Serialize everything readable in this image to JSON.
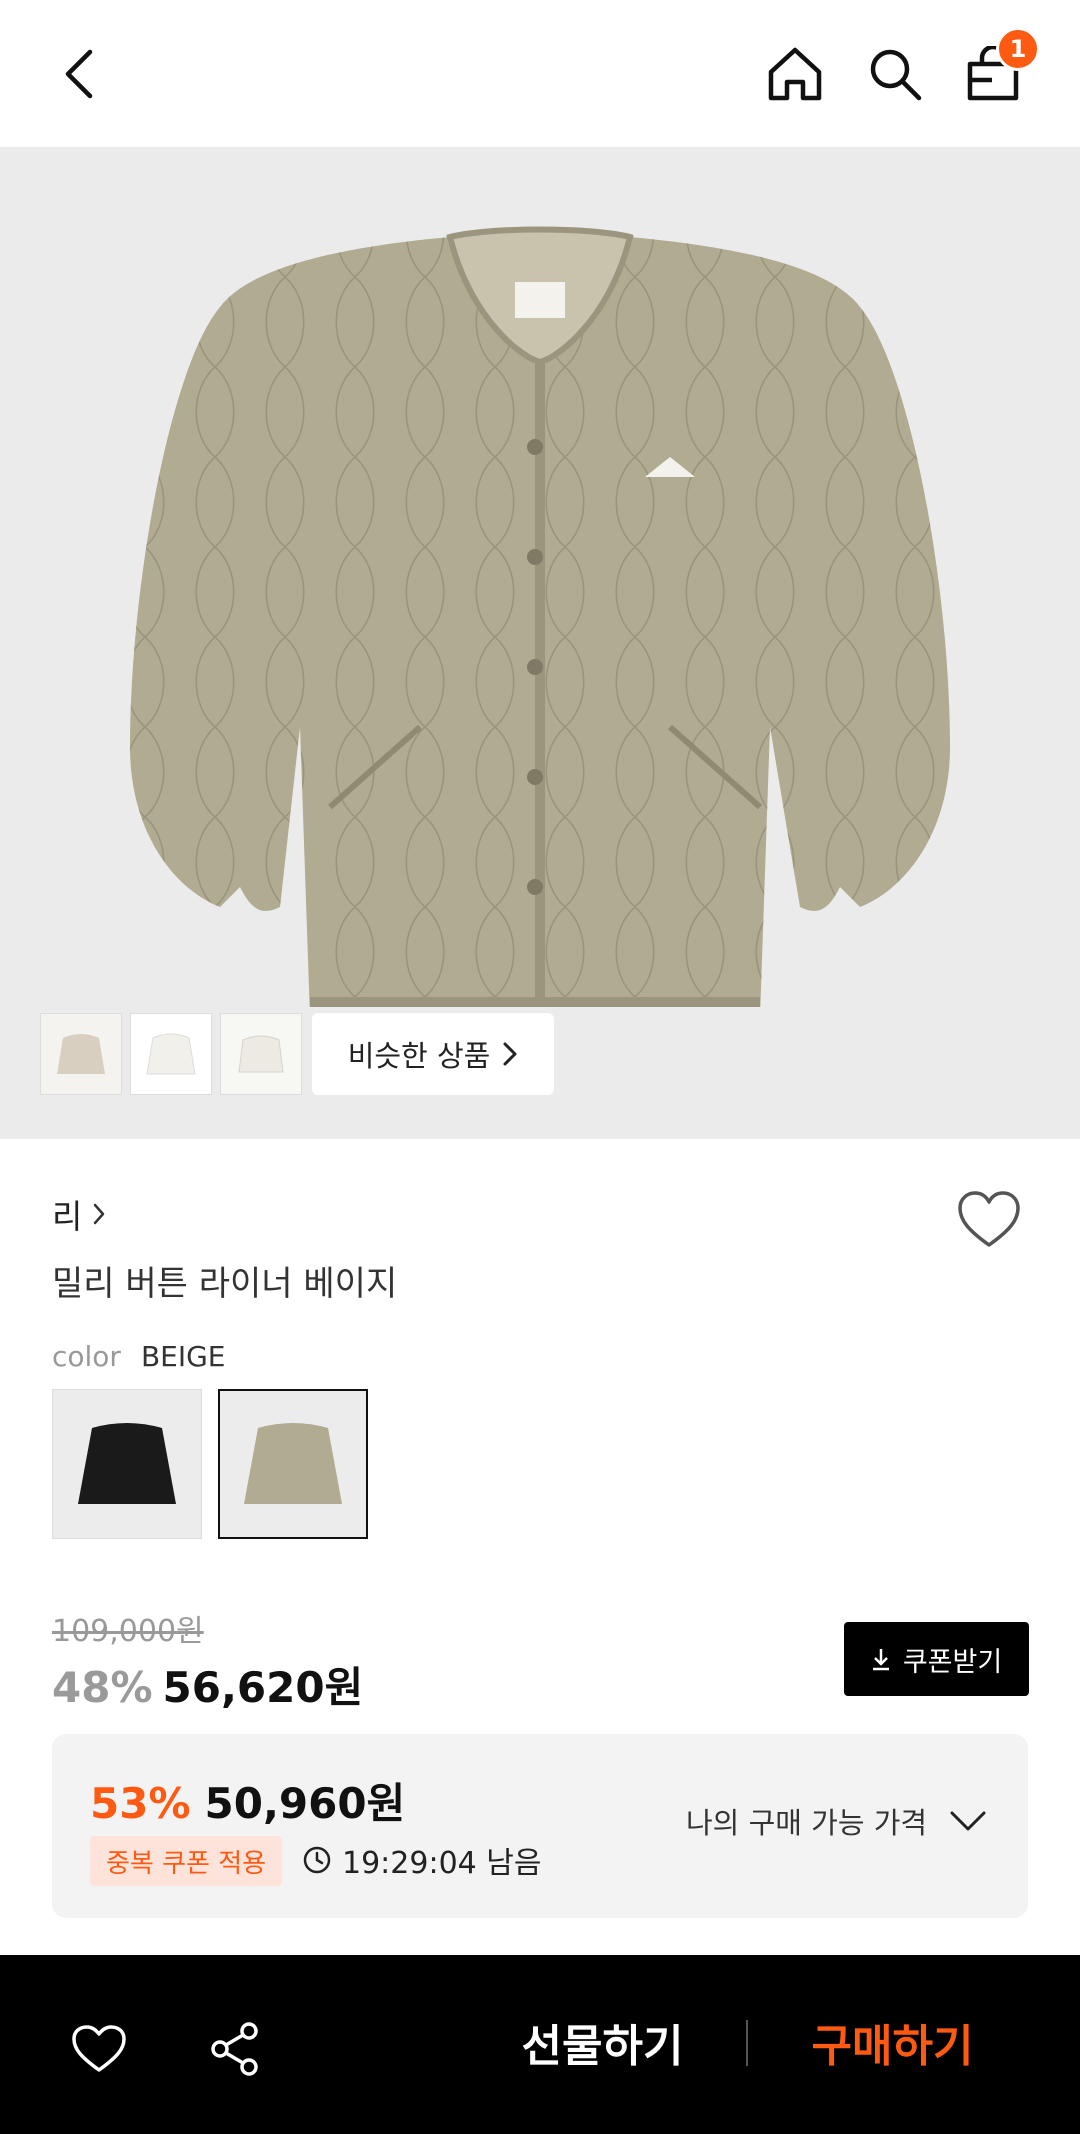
{
  "header": {
    "back_icon": "chevron-left-icon",
    "home_icon": "home-icon",
    "search_icon": "search-icon",
    "cart_icon": "shopping-bag-icon",
    "cart_count": "1",
    "badge_color": "#ff5a12"
  },
  "gallery": {
    "thumbnails": [
      "thumb-1",
      "thumb-2",
      "thumb-3"
    ],
    "similar_label": "비슷한 상품"
  },
  "product": {
    "brand": "리",
    "name": "밀리 버튼 라이너 베이지",
    "color_label": "color",
    "color_value": "BEIGE",
    "swatches": [
      "black",
      "beige"
    ],
    "selected_swatch": "beige"
  },
  "pricing": {
    "original_price": "109,000원",
    "discount": "48%",
    "price": "56,620원",
    "coupon_button": "쿠폰받기",
    "best": {
      "discount": "53%",
      "price": "50,960원",
      "tag": "중복 쿠폰 적용",
      "timer": "19:29:04 남음",
      "my_price_label": "나의 구매 가능 가격"
    }
  },
  "bottom_bar": {
    "gift_label": "선물하기",
    "buy_label": "구매하기",
    "accent_color": "#ff5a12"
  }
}
